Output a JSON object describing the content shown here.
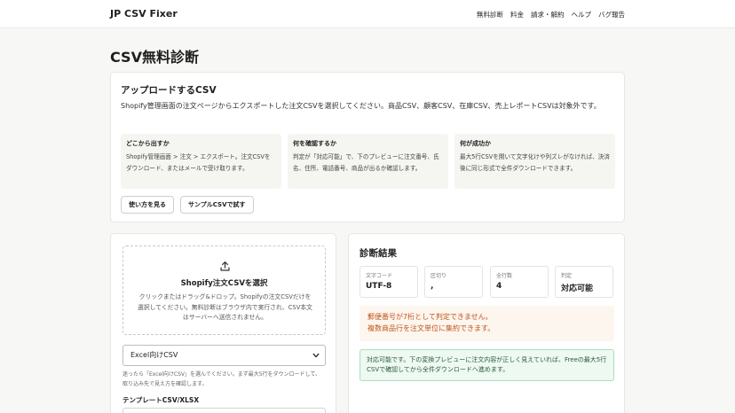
{
  "header": {
    "brand": "JP CSV Fixer",
    "nav": [
      "無料診断",
      "料金",
      "請求・解約",
      "ヘルプ",
      "バグ報告"
    ]
  },
  "page_title": "CSV無料診断",
  "upload": {
    "title": "アップロードするCSV",
    "description": "Shopify管理画面の注文ページからエクスポートした注文CSVを選択してください。商品CSV、顧客CSV、在庫CSV、売上レポートCSVは対象外です。",
    "info": [
      {
        "title": "どこから出すか",
        "body": "Shopify管理画面 > 注文 > エクスポート。注文CSVをダウンロード、またはメールで受け取ります。"
      },
      {
        "title": "何を確認するか",
        "body": "判定が「対応可能」で、下のプレビューに注文番号、氏名、住所、電話番号、商品が出るか確認します。"
      },
      {
        "title": "何が成功か",
        "body": "最大5行CSVを開いて文字化けや列ズレがなければ、決済後に同じ形式で全件ダウンロードできます。"
      }
    ],
    "buttons": {
      "howto": "使い方を見る",
      "sample": "サンプルCSVで試す"
    }
  },
  "dropzone": {
    "title": "Shopify注文CSVを選択",
    "desc": "クリックまたはドラッグ&ドロップ。Shopifyの注文CSVだけを選択してください。無料診断はブラウザ内で実行され、CSV本文はサーバーへ送信されません。",
    "icon": "upload-icon"
  },
  "format_select": {
    "selected": "Excel向けCSV",
    "help": "迷ったら「Excel向けCSV」を選んでください。まず最大5行をダウンロードして、取り込み先で見え方を確認します。"
  },
  "template": {
    "label": "テンプレートCSV/XLSX"
  },
  "results": {
    "title": "診断結果",
    "stats": [
      {
        "label": "文字コード",
        "value": "UTF-8"
      },
      {
        "label": "区切り",
        "value": ","
      },
      {
        "label": "全行数",
        "value": "4"
      },
      {
        "label": "判定",
        "value": "対応可能"
      }
    ],
    "errors": [
      "郵便番号が7桁として判定できません。",
      "複数商品行を注文単位に集約できます。"
    ],
    "ok_message": "対応可能です。下の変換プレビューに注文内容が正しく見えていれば、Freeの最大5行CSVで確認してから全件ダウンロードへ進めます。",
    "colors": {
      "error": "#c0561d",
      "ok_bg": "#edf9f1",
      "ok_border": "#a9dfbd"
    }
  }
}
